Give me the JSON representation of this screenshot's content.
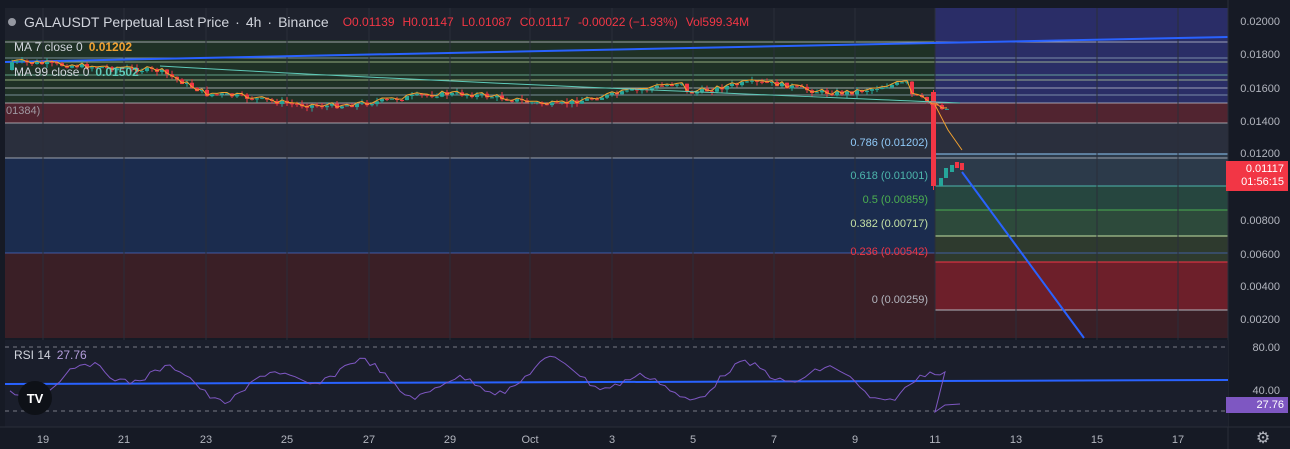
{
  "header": {
    "symbol": "GALAUSDT Perpetual Last Price",
    "sep1": "·",
    "interval": "4h",
    "sep2": "·",
    "exchange": "Binance",
    "open": "O0.01139",
    "high": "H0.01147",
    "low": "L0.01087",
    "close": "C0.01117",
    "change": "-0.00022 (−1.93%)",
    "volume": "Vol599.34M"
  },
  "indicators": {
    "ma7_label": "MA 7 close 0",
    "ma7_value": "0.01202",
    "ma99_label": "MA 99 close 0",
    "ma99_value": "0.01502",
    "rsi_label": "RSI 14",
    "rsi_value": "27.76"
  },
  "ghost_labels": [
    "01384)"
  ],
  "price_axis": {
    "labels": [
      "0.02000",
      "0.01800",
      "0.01600",
      "0.01400",
      "0.01200",
      "0.00800",
      "0.00600",
      "0.00400",
      "0.00200"
    ],
    "current_price": "0.01117",
    "countdown": "01:56:15"
  },
  "rsi_axis": {
    "labels": [
      "80.00",
      "40.00"
    ],
    "current": "27.76"
  },
  "time_axis": {
    "labels": [
      "19",
      "21",
      "23",
      "25",
      "27",
      "29",
      "Oct",
      "3",
      "5",
      "7",
      "9",
      "11",
      "13",
      "15",
      "17"
    ]
  },
  "fib_levels": [
    {
      "label": "0.786 (0.01202)",
      "color": "#90caf9"
    },
    {
      "label": "0.618 (0.01001)",
      "color": "#4db6ac"
    },
    {
      "label": "0.5 (0.00859)",
      "color": "#4caf50"
    },
    {
      "label": "0.382 (0.00717)",
      "color": "#c5e1a5"
    },
    {
      "label": "0.236 (0.00542)",
      "color": "#f23645"
    },
    {
      "label": "0 (0.00259)",
      "color": "#b2b5be"
    }
  ],
  "colors": {
    "bg": "#161a25",
    "up": "#26a69a",
    "down": "#f23645",
    "ma7": "#f0a030",
    "ma99": "#5fc9b8",
    "trend": "#2962ff",
    "rsi": "#7e57c2"
  },
  "logo_text": "TV",
  "gear_icon": "gear-icon"
}
